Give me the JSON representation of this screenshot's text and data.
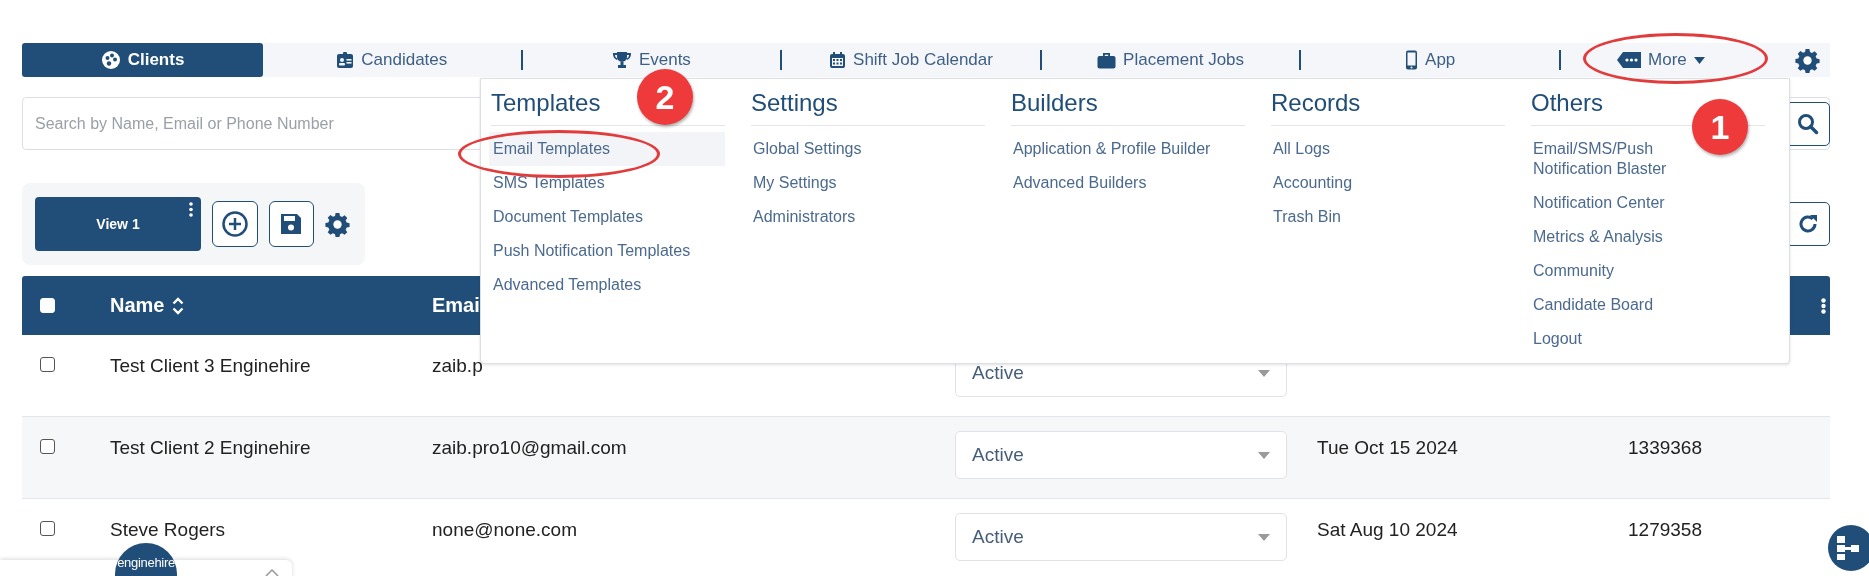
{
  "nav": {
    "tabs": [
      {
        "label": "Clients",
        "selected": true
      },
      {
        "label": "Candidates",
        "selected": false
      },
      {
        "label": "Events",
        "selected": false
      },
      {
        "label": "Shift Job Calendar",
        "selected": false
      },
      {
        "label": "Placement Jobs",
        "selected": false
      },
      {
        "label": "App",
        "selected": false
      }
    ],
    "more": {
      "label": "More",
      "expanded": true
    }
  },
  "search": {
    "placeholder": "Search by Name, Email or Phone Number"
  },
  "views": [
    {
      "label": "View 1",
      "selected": true
    }
  ],
  "table": {
    "all_checked": false,
    "columns": [
      "Name",
      "Emai"
    ],
    "rows": [
      {
        "checked": false,
        "name": "Test Client 3 Enginehire",
        "email": "zaib.p",
        "status": "Active"
      },
      {
        "checked": false,
        "name": "Test Client 2 Enginehire",
        "email": "zaib.pro10@gmail.com",
        "status": "Active",
        "date": "Tue Oct 15 2024",
        "id": "1339368"
      },
      {
        "checked": false,
        "name": "Steve Rogers",
        "email": "none@none.com",
        "status": "Active",
        "date": "Sat Aug 10 2024",
        "id": "1279358"
      }
    ]
  },
  "menu": {
    "columns": [
      {
        "title": "Templates",
        "items": [
          {
            "label": "Email Templates",
            "selected": true
          },
          {
            "label": "SMS Templates",
            "selected": false
          },
          {
            "label": "Document Templates",
            "selected": false
          },
          {
            "label": "Push Notification Templates",
            "selected": false
          },
          {
            "label": "Advanced Templates",
            "selected": false
          }
        ]
      },
      {
        "title": "Settings",
        "items": [
          {
            "label": "Global Settings",
            "selected": false
          },
          {
            "label": "My Settings",
            "selected": false
          },
          {
            "label": "Administrators",
            "selected": false
          }
        ]
      },
      {
        "title": "Builders",
        "items": [
          {
            "label": "Application & Profile Builder",
            "selected": false
          },
          {
            "label": "Advanced Builders",
            "selected": false
          }
        ]
      },
      {
        "title": "Records",
        "items": [
          {
            "label": "All Logs",
            "selected": false
          },
          {
            "label": "Accounting",
            "selected": false
          },
          {
            "label": "Trash Bin",
            "selected": false
          }
        ]
      },
      {
        "title": "Others",
        "items": [
          {
            "label": "Email/SMS/Push Notification Blaster",
            "selected": false
          },
          {
            "label": "Notification Center",
            "selected": false
          },
          {
            "label": "Metrics & Analysis",
            "selected": false
          },
          {
            "label": "Community",
            "selected": false
          },
          {
            "label": "Candidate Board",
            "selected": false
          },
          {
            "label": "Logout",
            "selected": false
          }
        ]
      }
    ]
  },
  "annotations": [
    {
      "label": "1"
    },
    {
      "label": "2"
    }
  ],
  "chat_widget": {
    "logo": "enginehire"
  }
}
